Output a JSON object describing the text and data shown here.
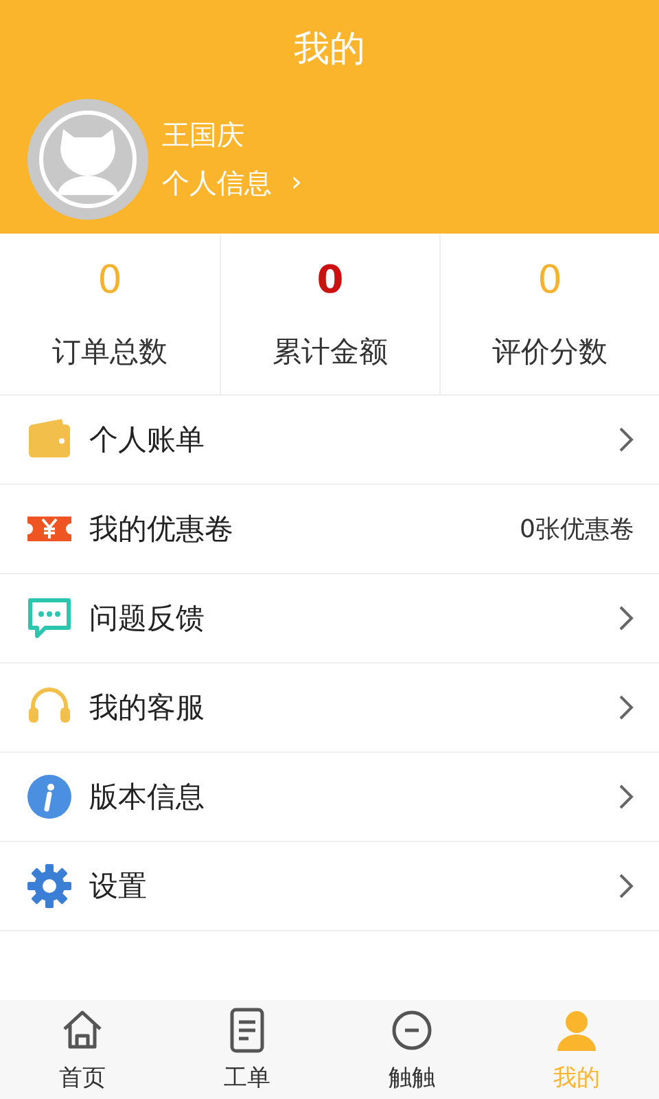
{
  "header": {
    "title": "我的"
  },
  "profile": {
    "name": "王国庆",
    "link": "个人信息",
    "chevron": "›"
  },
  "stats": [
    {
      "value": "0",
      "label": "订单总数",
      "color": "#f5b22e"
    },
    {
      "value": "0",
      "label": "累计金额",
      "color": "#cc1111"
    },
    {
      "value": "0",
      "label": "评价分数",
      "color": "#f5b22e"
    }
  ],
  "menu": [
    {
      "label": "个人账单",
      "kind": "chevron"
    },
    {
      "label": "我的优惠卷",
      "kind": "value",
      "value": "0张优惠卷"
    },
    {
      "label": "问题反馈",
      "kind": "chevron"
    },
    {
      "label": "我的客服",
      "kind": "chevron"
    },
    {
      "label": "版本信息",
      "kind": "chevron"
    },
    {
      "label": "设置",
      "kind": "chevron"
    }
  ],
  "tab_bar": [
    {
      "label": "首页",
      "selected": false
    },
    {
      "label": "工单",
      "selected": false
    },
    {
      "label": "触触",
      "selected": false
    },
    {
      "label": "我的",
      "selected": true
    }
  ]
}
